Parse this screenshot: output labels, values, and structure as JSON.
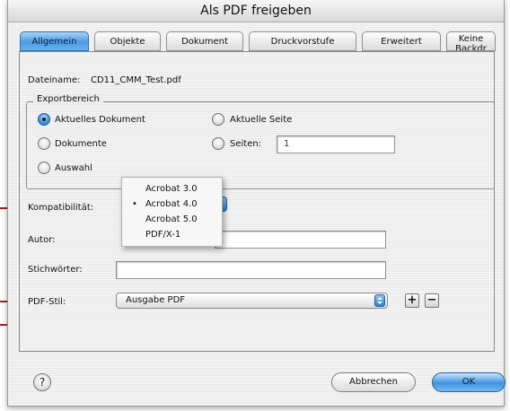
{
  "window": {
    "title": "Als PDF freigeben"
  },
  "tabs": [
    {
      "label": "Allgemein",
      "active": true
    },
    {
      "label": "Objekte"
    },
    {
      "label": "Dokument"
    },
    {
      "label": "Druckvorstufe"
    },
    {
      "label": "Erweitert"
    },
    {
      "label": "Keine Backdr"
    }
  ],
  "file": {
    "label": "Dateiname:",
    "value": "CD11_CMM_Test.pdf"
  },
  "export_range": {
    "title": "Exportbereich",
    "options": {
      "current_document": "Aktuelles Dokument",
      "documents": "Dokumente",
      "selection": "Auswahl",
      "current_page": "Aktuelle Seite",
      "pages": "Seiten:"
    },
    "selected": "Aktuelles Dokument",
    "pages_value": "1"
  },
  "compatibility": {
    "label": "Kompatibilität:",
    "menu": [
      "Acrobat 3.0",
      "Acrobat 4.0",
      "Acrobat 5.0",
      "PDF/X-1"
    ],
    "selected": "Acrobat 4.0",
    "check_mark": "•"
  },
  "author": {
    "label": "Autor:",
    "value": ""
  },
  "keywords": {
    "label": "Stichwörter:",
    "value": ""
  },
  "pdf_style": {
    "label": "PDF-Stil:",
    "value": "Ausgabe PDF",
    "add_label": "+",
    "remove_label": "−"
  },
  "buttons": {
    "help": "?",
    "cancel": "Abbrechen",
    "ok": "OK"
  },
  "colors": {
    "accent": "#4b9be0",
    "callout": "#a3231c",
    "background": "#ececec"
  }
}
